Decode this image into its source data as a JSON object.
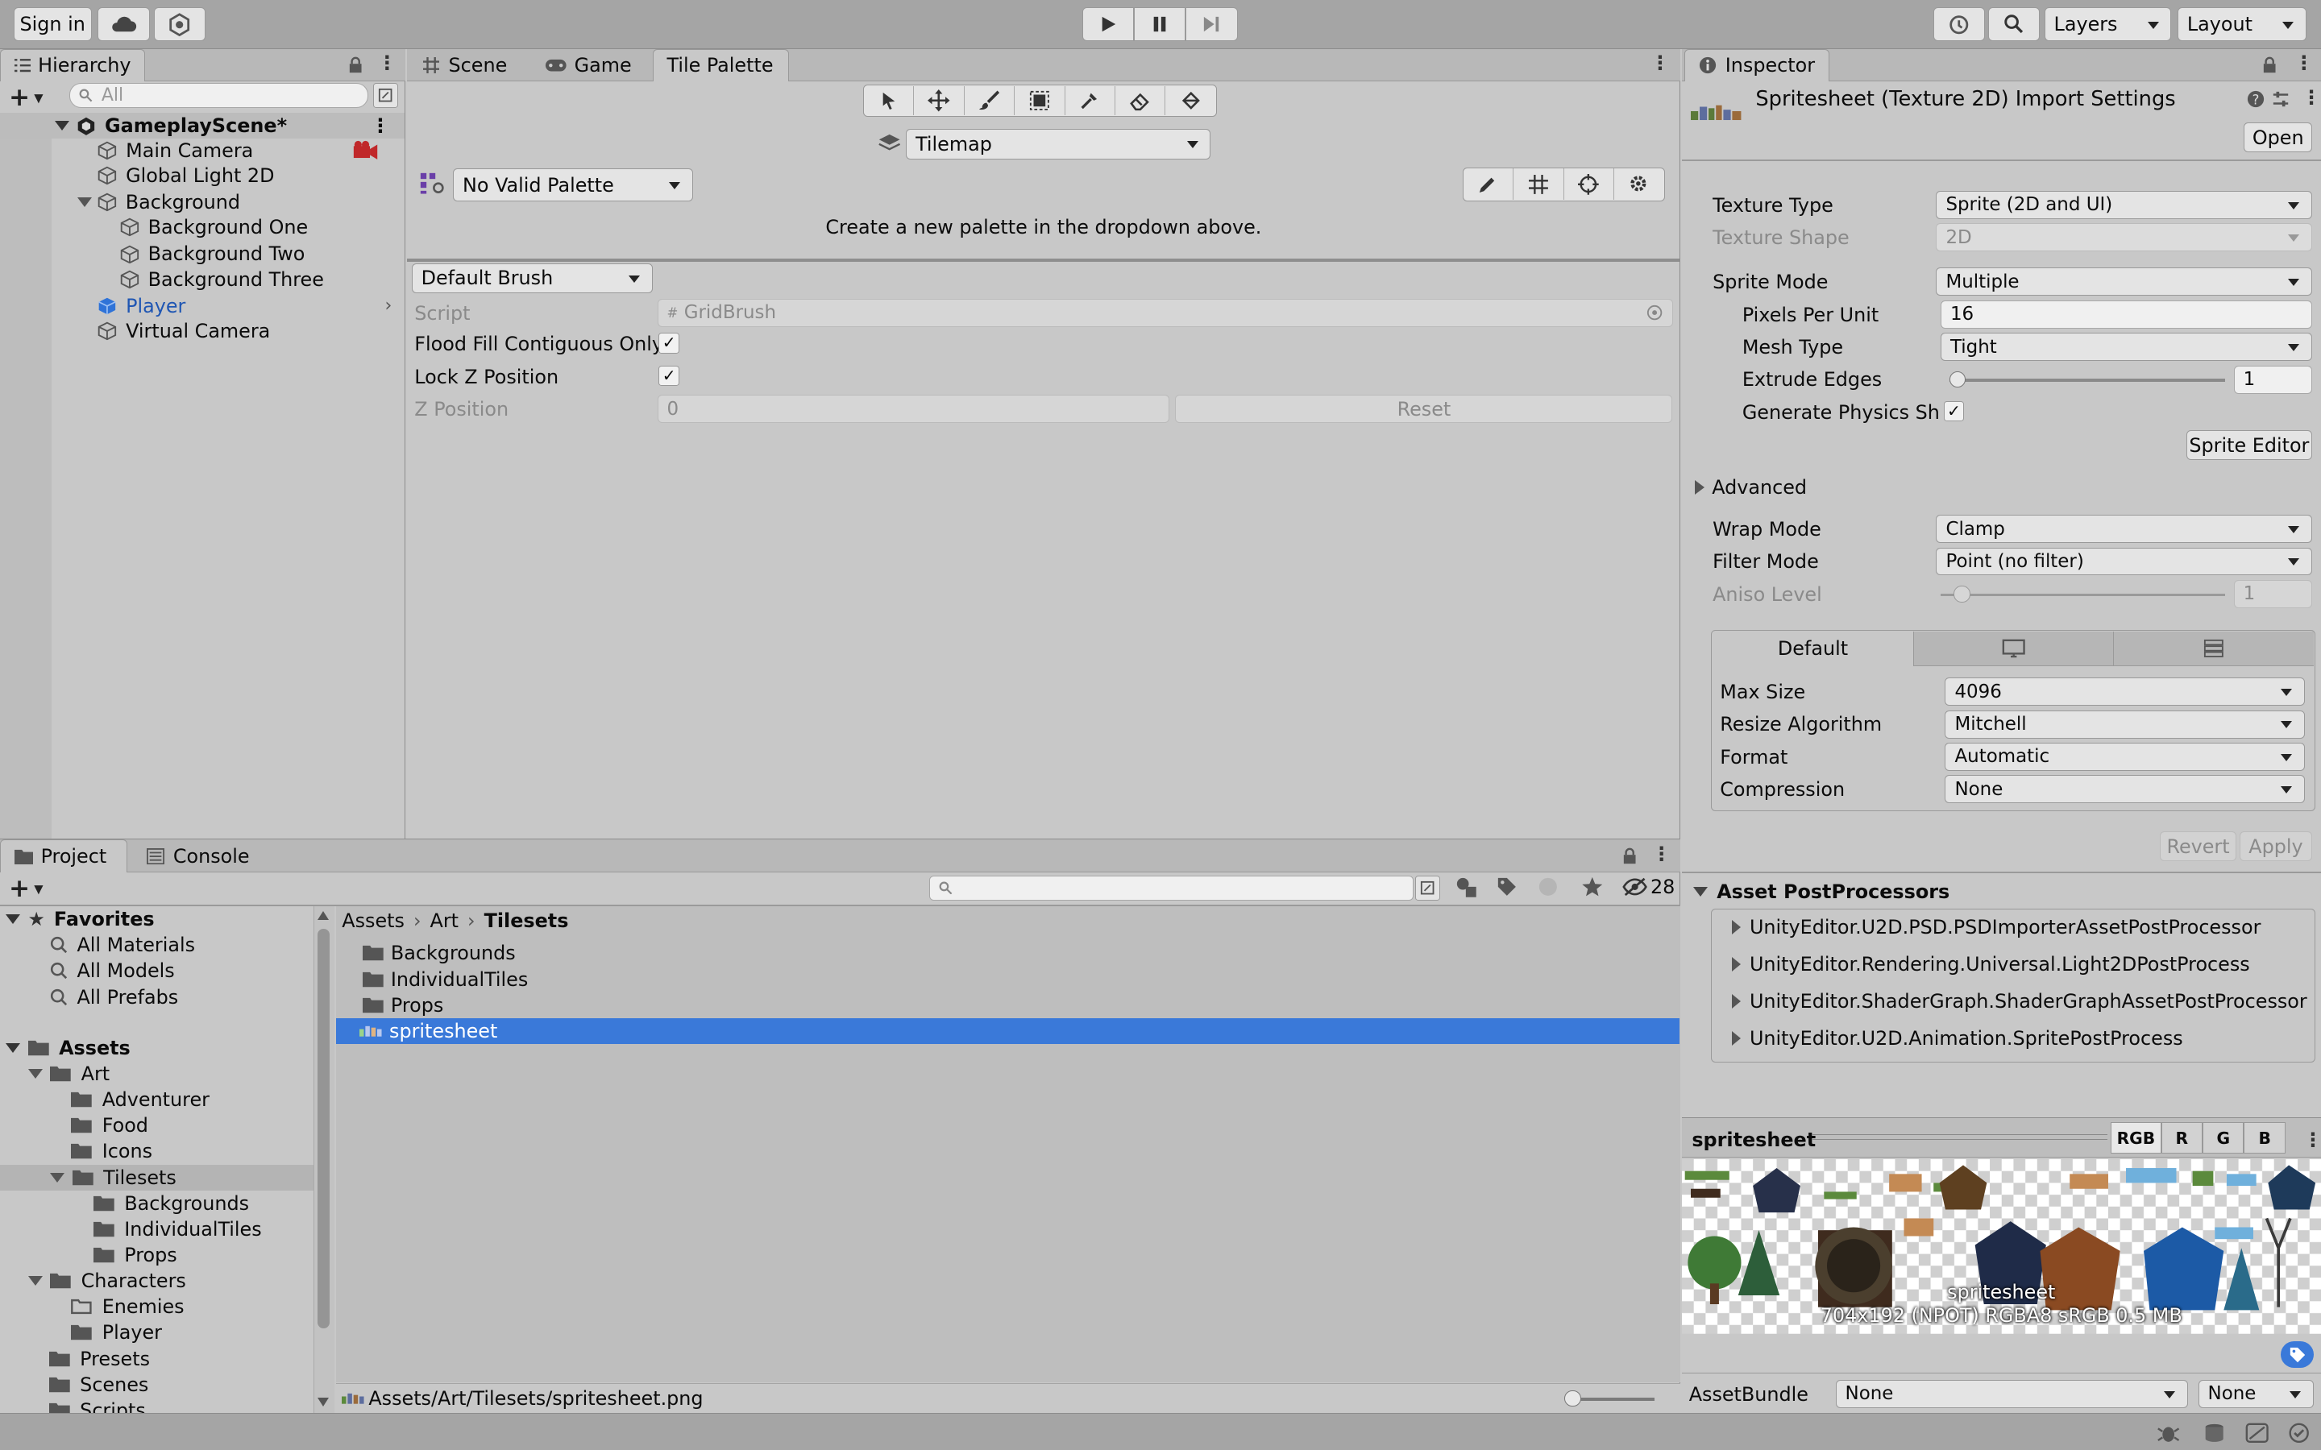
{
  "toolbar": {
    "sign_in": "Sign in",
    "layers": "Layers",
    "layout": "Layout"
  },
  "hierarchy": {
    "tab": "Hierarchy",
    "search_placeholder": "All",
    "items": [
      {
        "label": "GameplayScene*"
      },
      {
        "label": "Main Camera"
      },
      {
        "label": "Global Light 2D"
      },
      {
        "label": "Background"
      },
      {
        "label": "Background One"
      },
      {
        "label": "Background Two"
      },
      {
        "label": "Background Three"
      },
      {
        "label": "Player"
      },
      {
        "label": "Virtual Camera"
      }
    ]
  },
  "center": {
    "tabs": [
      "Scene",
      "Game",
      "Tile Palette"
    ],
    "tilemap": "Tilemap",
    "palette": "No Valid Palette",
    "message": "Create a new palette in the dropdown above.",
    "brush": "Default Brush",
    "props": {
      "script_label": "Script",
      "script_value": "GridBrush",
      "flood_label": "Flood Fill Contiguous Only",
      "lockz_label": "Lock Z Position",
      "zpos_label": "Z Position",
      "zpos_value": "0",
      "reset": "Reset"
    }
  },
  "inspector": {
    "tab": "Inspector",
    "title": "Spritesheet (Texture 2D) Import Settings",
    "open": "Open",
    "texture_type_label": "Texture Type",
    "texture_type": "Sprite (2D and UI)",
    "texture_shape_label": "Texture Shape",
    "texture_shape": "2D",
    "sprite_mode_label": "Sprite Mode",
    "sprite_mode": "Multiple",
    "ppu_label": "Pixels Per Unit",
    "ppu": "16",
    "mesh_type_label": "Mesh Type",
    "mesh_type": "Tight",
    "extrude_label": "Extrude Edges",
    "extrude": "1",
    "physics_label": "Generate Physics Sha",
    "sprite_editor": "Sprite Editor",
    "advanced": "Advanced",
    "wrap_label": "Wrap Mode",
    "wrap": "Clamp",
    "filter_label": "Filter Mode",
    "filter": "Point (no filter)",
    "aniso_label": "Aniso Level",
    "aniso": "1",
    "platform_default": "Default",
    "max_size_label": "Max Size",
    "max_size": "4096",
    "resize_label": "Resize Algorithm",
    "resize": "Mitchell",
    "format_label": "Format",
    "format": "Automatic",
    "compression_label": "Compression",
    "compression": "None",
    "revert": "Revert",
    "apply": "Apply",
    "postprocessors_title": "Asset PostProcessors",
    "postprocessors": [
      "UnityEditor.U2D.PSD.PSDImporterAssetPostProcessor",
      "UnityEditor.Rendering.Universal.Light2DPostProcess",
      "UnityEditor.ShaderGraph.ShaderGraphAssetPostProcessor",
      "UnityEditor.U2D.Animation.SpritePostProcess"
    ],
    "preview_title": "spritesheet",
    "channels": [
      "RGB",
      "R",
      "G",
      "B"
    ],
    "preview_name": "spritesheet",
    "preview_info": "704x192 (NPOT)  RGBA8 sRGB  0.5 MB",
    "assetbundle_label": "AssetBundle",
    "assetbundle": "None",
    "assetbundle_variant": "None"
  },
  "project": {
    "tabs": [
      "Project",
      "Console"
    ],
    "hidden_count": "28",
    "tree": [
      {
        "label": "Favorites"
      },
      {
        "label": "All Materials"
      },
      {
        "label": "All Models"
      },
      {
        "label": "All Prefabs"
      },
      {
        "label": "Assets"
      },
      {
        "label": "Art"
      },
      {
        "label": "Adventurer"
      },
      {
        "label": "Food"
      },
      {
        "label": "Icons"
      },
      {
        "label": "Tilesets"
      },
      {
        "label": "Backgrounds"
      },
      {
        "label": "IndividualTiles"
      },
      {
        "label": "Props"
      },
      {
        "label": "Characters"
      },
      {
        "label": "Enemies"
      },
      {
        "label": "Player"
      },
      {
        "label": "Presets"
      },
      {
        "label": "Scenes"
      },
      {
        "label": "Scripts"
      }
    ],
    "breadcrumb": [
      "Assets",
      "Art",
      "Tilesets"
    ],
    "files": [
      "Backgrounds",
      "IndividualTiles",
      "Props",
      "spritesheet"
    ],
    "path": "Assets/Art/Tilesets/spritesheet.png"
  },
  "colors": {
    "selection": "#3a79d9",
    "player_blue": "#1f56b3",
    "panel": "#c8c8c8",
    "toolbar": "#a5a5a5"
  }
}
